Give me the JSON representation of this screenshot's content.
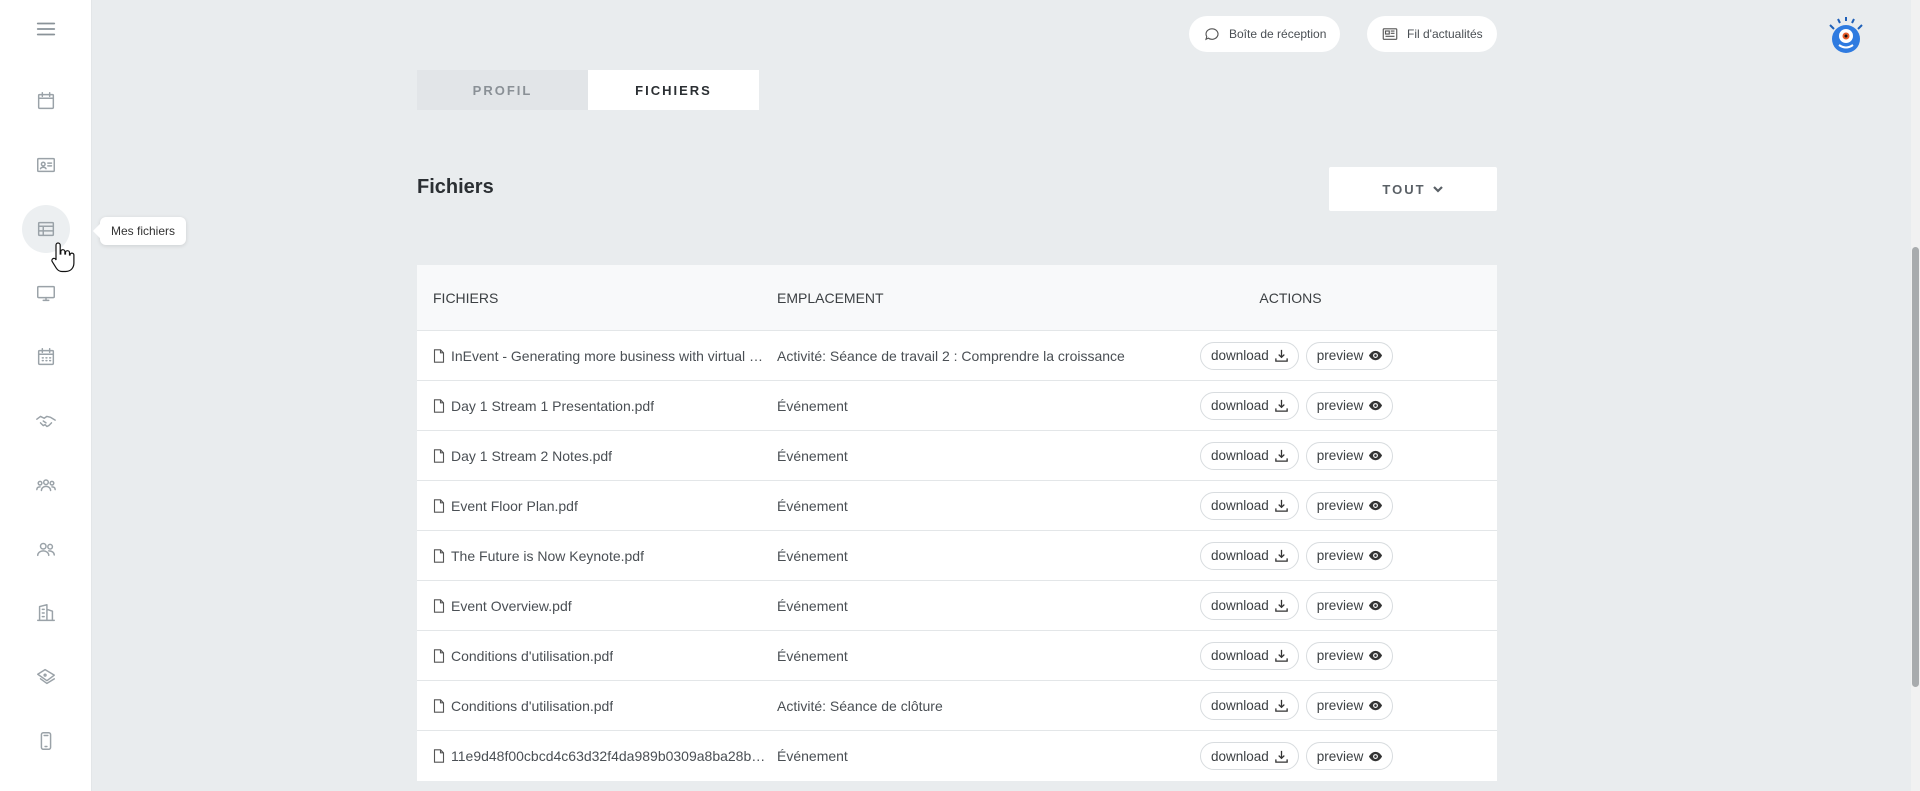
{
  "sidebar": {
    "tooltip": "Mes fichiers",
    "items": [
      {
        "name": "menu-icon"
      },
      {
        "name": "calendar-icon"
      },
      {
        "name": "id-card-icon"
      },
      {
        "name": "table-icon"
      },
      {
        "name": "monitor-icon"
      },
      {
        "name": "calendar-grid-icon"
      },
      {
        "name": "handshake-icon"
      },
      {
        "name": "group-icon"
      },
      {
        "name": "people-icon"
      },
      {
        "name": "building-icon"
      },
      {
        "name": "tickets-icon"
      },
      {
        "name": "phone-icon"
      }
    ]
  },
  "header": {
    "inbox_label": "Boîte de réception",
    "feed_label": "Fil d'actualités"
  },
  "tabs": [
    {
      "label": "PROFIL",
      "active": false
    },
    {
      "label": "FICHIERS",
      "active": true
    }
  ],
  "section": {
    "title": "Fichiers",
    "filter_label": "TOUT"
  },
  "table": {
    "headers": {
      "files": "FICHIERS",
      "location": "EMPLACEMENT",
      "actions": "ACTIONS"
    },
    "download_label": "download",
    "preview_label": "preview",
    "rows": [
      {
        "file": "InEvent - Generating more business with virtual eve...",
        "location": "Activité: Séance de travail 2 : Comprendre la croissance"
      },
      {
        "file": "Day 1 Stream 1 Presentation.pdf",
        "location": "Événement"
      },
      {
        "file": "Day 1 Stream 2 Notes.pdf",
        "location": "Événement"
      },
      {
        "file": "Event Floor Plan.pdf",
        "location": "Événement"
      },
      {
        "file": "The Future is Now Keynote.pdf",
        "location": "Événement"
      },
      {
        "file": "Event Overview.pdf",
        "location": "Événement"
      },
      {
        "file": "Conditions d'utilisation.pdf",
        "location": "Événement"
      },
      {
        "file": "Conditions d'utilisation.pdf",
        "location": "Activité: Séance de clôture"
      },
      {
        "file": "11e9d48f00cbcd4c63d32f4da989b0309a8ba28b....",
        "location": "Événement"
      }
    ]
  }
}
